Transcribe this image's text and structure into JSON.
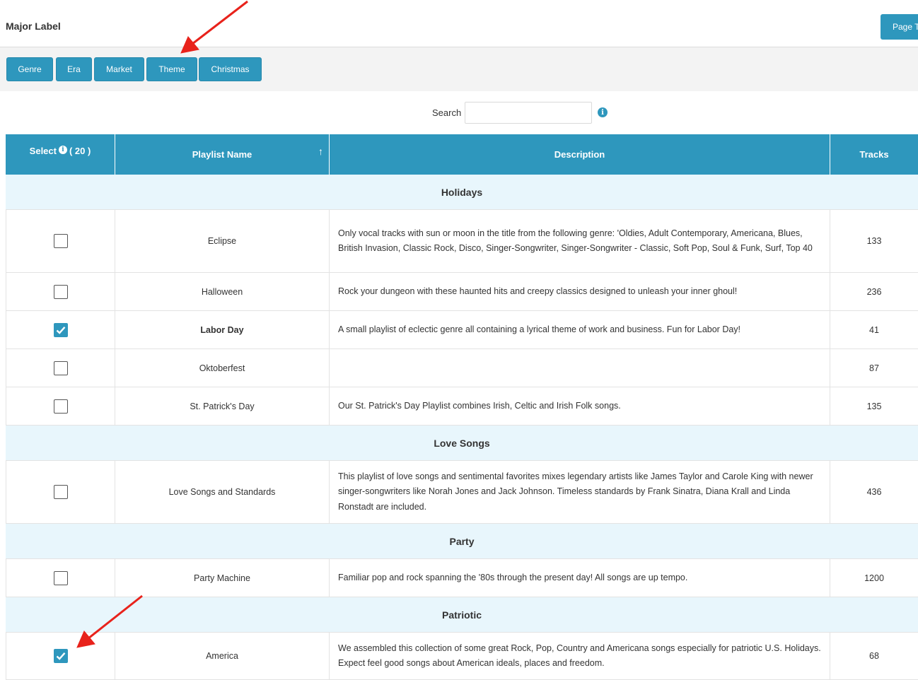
{
  "header": {
    "title": "Major Label",
    "page_button": "Page T"
  },
  "filter_tabs": [
    "Genre",
    "Era",
    "Market",
    "Theme",
    "Christmas"
  ],
  "search": {
    "label": "Search",
    "value": ""
  },
  "table": {
    "columns": {
      "select": "Select",
      "select_count": "( 20 )",
      "name": "Playlist Name",
      "description": "Description",
      "tracks": "Tracks"
    },
    "groups": [
      {
        "name": "Holidays",
        "rows": [
          {
            "checked": false,
            "name": "Eclipse",
            "description": "Only vocal tracks with sun or moon in the title from the following genre: 'Oldies, Adult Contemporary, Americana, Blues, British Invasion, Classic Rock, Disco, Singer-Songwriter, Singer-Songwriter - Classic, Soft Pop, Soul & Funk, Surf, Top 40",
            "tracks": "133"
          },
          {
            "checked": false,
            "name": "Halloween",
            "description": "Rock your dungeon with these haunted hits and creepy classics designed to unleash your inner ghoul!",
            "tracks": "236"
          },
          {
            "checked": true,
            "name": "Labor Day",
            "description": "A small playlist of eclectic genre all containing a lyrical theme of work and business. Fun for Labor Day!",
            "tracks": "41"
          },
          {
            "checked": false,
            "name": "Oktoberfest",
            "description": "",
            "tracks": "87"
          },
          {
            "checked": false,
            "name": "St. Patrick's Day",
            "description": "Our St. Patrick's Day Playlist combines Irish, Celtic and Irish Folk songs.",
            "tracks": "135"
          }
        ]
      },
      {
        "name": "Love Songs",
        "rows": [
          {
            "checked": false,
            "name": "Love Songs and Standards",
            "description": "This playlist of love songs and sentimental favorites mixes legendary artists like James Taylor and Carole King with newer singer-songwriters like Norah Jones and Jack Johnson. Timeless standards by Frank Sinatra, Diana Krall and Linda Ronstadt are included.",
            "tracks": "436"
          }
        ]
      },
      {
        "name": "Party",
        "rows": [
          {
            "checked": false,
            "name": "Party Machine",
            "description": "Familiar pop and rock spanning the '80s through the present day! All songs are up tempo.",
            "tracks": "1200"
          }
        ]
      },
      {
        "name": "Patriotic",
        "rows": [
          {
            "checked": true,
            "name": "America",
            "description": "We assembled this collection of some great Rock, Pop, Country and Americana songs especially for patriotic U.S. Holidays. Expect feel good songs about American ideals, places and freedom.",
            "tracks": "68"
          }
        ]
      }
    ]
  },
  "colors": {
    "accent": "#2e97bd",
    "group_bg": "#e8f6fc",
    "annotation_arrow": "#e8221b"
  }
}
